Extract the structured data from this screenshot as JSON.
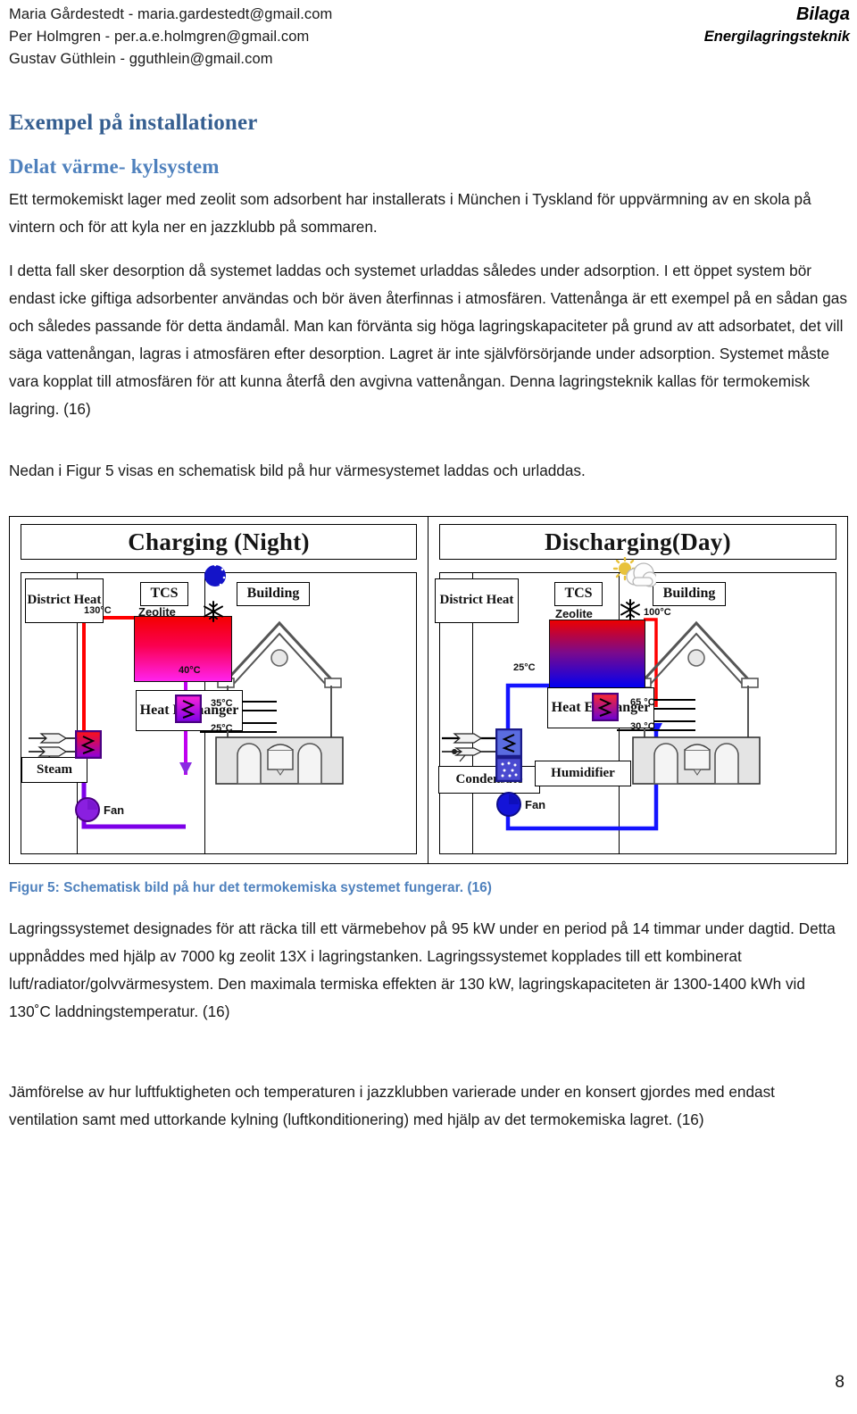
{
  "header": {
    "authors": [
      "Maria Gårdestedt - maria.gardestedt@gmail.com",
      "Per Holmgren - per.a.e.holmgren@gmail.com",
      "Gustav Güthlein - gguthlein@gmail.com"
    ],
    "right_title": "Bilaga",
    "right_subtitle": "Energilagringsteknik"
  },
  "headings": {
    "h1": "Exempel på installationer",
    "h2": "Delat värme- kylsystem",
    "h1_color": "#365f91",
    "h2_color": "#4f81bd"
  },
  "paragraphs": {
    "intro": "Ett termokemiskt lager med zeolit som adsorbent har installerats i München i Tyskland för uppvärmning av en skola på vintern och för att kyla ner en jazzklubb på sommaren.",
    "main": "I detta fall sker desorption då systemet laddas och systemet urladdas således under adsorption. I ett öppet system bör endast icke giftiga adsorbenter användas och bör även återfinnas i atmosfären. Vattenånga är ett exempel på en sådan gas och således passande för detta ändamål. Man kan förvänta sig höga lagringskapaciteter på grund av att adsorbatet, det vill säga vattenångan, lagras i atmosfären efter desorption. Lagret är inte självförsörjande under adsorption. Systemet måste vara kopplat till atmosfären för att kunna återfå den avgivna vattenångan. Denna lagringsteknik kallas för termokemisk lagring. (16)",
    "fig_intro": "Nedan i Figur 5 visas en schematisk bild på hur värmesystemet laddas och urladdas.",
    "after1": "Lagringssystemet designades för att räcka till ett värmebehov på 95 kW under en period på 14 timmar under dagtid. Detta uppnåddes med hjälp av 7000 kg zeolit 13X i lagringstanken. Lagringssystemet kopplades till ett kombinerat luft/radiator/golvvärmesystem. Den maximala termiska effekten är 130 kW, lagringskapaciteten är 1300-1400 kWh vid 130˚C laddningstemperatur. (16)",
    "after2": "Jämförelse av hur luftfuktigheten och temperaturen i jazzklubben varierade under en konsert gjordes med endast ventilation samt med uttorkande kylning (luftkonditionering) med hjälp av det termokemiska lagret. (16)"
  },
  "figure": {
    "caption": "Figur 5: Schematisk bild på hur det termokemiska systemet fungerar. (16)",
    "charging": {
      "title": "Charging (Night)",
      "district_heat": "District Heat",
      "tcs": "TCS",
      "zeolite": "Zeolite",
      "heat_exchanger": "Heat Exchanger",
      "building": "Building",
      "steam": "Steam",
      "fan": "Fan",
      "temps": {
        "tank_in": "130°C",
        "tank_out": "40°C",
        "supply": "35°C",
        "return": "25°C"
      },
      "weather_icon": "moon-icon",
      "snow_icon": "snowflake-icon"
    },
    "discharging": {
      "title": "Discharging(Day)",
      "district_heat": "District Heat",
      "tcs": "TCS",
      "zeolite": "Zeolite",
      "heat_exchanger": "Heat Exchanger",
      "building": "Building",
      "condensate": "Condensate",
      "humidifier": "Humidifier",
      "fan": "Fan",
      "temps": {
        "tank_out": "100°C",
        "tank_in": "25°C",
        "supply": "65 °C",
        "return": "30 °C"
      },
      "weather_icon": "sun-cloud-icon",
      "snow_icon": "snowflake-icon"
    }
  },
  "footer": {
    "page_number": "8"
  }
}
